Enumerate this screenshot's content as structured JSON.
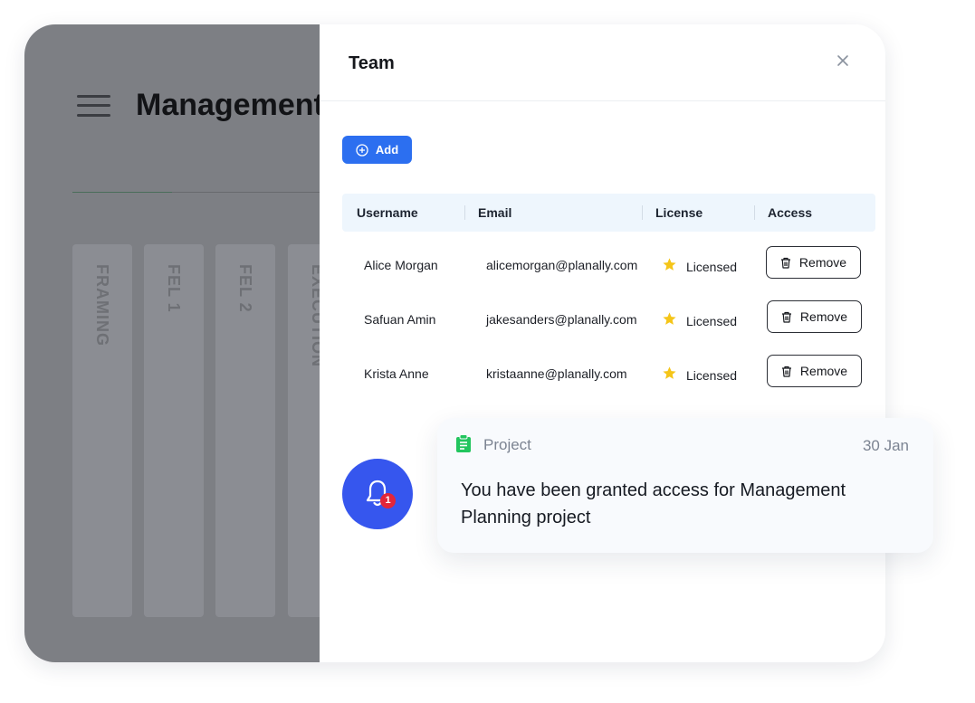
{
  "background_app": {
    "title": "Management",
    "stages": [
      "FRAMING",
      "FEL 1",
      "FEL 2",
      "EXECUTION"
    ]
  },
  "team_panel": {
    "title": "Team",
    "add_label": "Add",
    "columns": [
      "Username",
      "Email",
      "License",
      "Access"
    ],
    "rows": [
      {
        "username": "Alice Morgan",
        "email": "alicemorgan@planally.com",
        "license": "Licensed",
        "action": "Remove"
      },
      {
        "username": "Safuan Amin",
        "email": "jakesanders@planally.com",
        "license": "Licensed",
        "action": "Remove"
      },
      {
        "username": "Krista Anne",
        "email": "kristaanne@planally.com",
        "license": "Licensed",
        "action": "Remove"
      }
    ]
  },
  "notification": {
    "badge_count": "1",
    "category": "Project",
    "date": "30 Jan",
    "message": "You have been granted access for Management Planning project"
  },
  "colors": {
    "primary": "#2c6ff0",
    "bell": "#3656ee",
    "badge": "#e2263a",
    "star": "#f5c518",
    "project_icon": "#22c55e",
    "overlay": "#7d7f84"
  }
}
